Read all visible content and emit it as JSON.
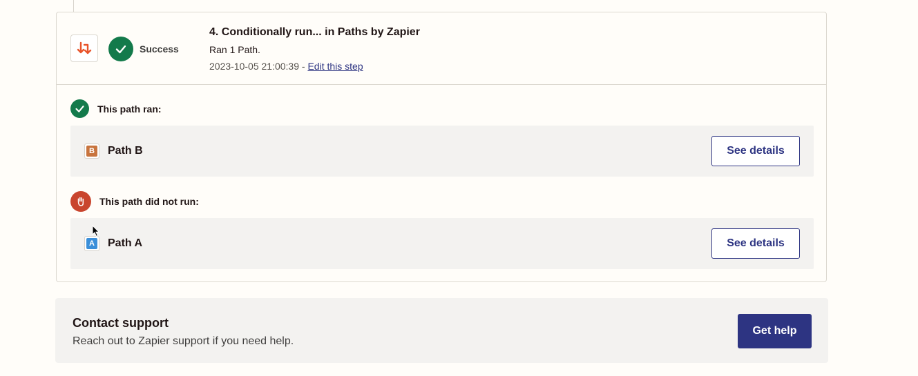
{
  "step": {
    "status": "Success",
    "title": "4. Conditionally run... in Paths by Zapier",
    "subtitle": "Ran 1 Path.",
    "timestamp": "2023-10-05 21:00:39",
    "separator": " - ",
    "edit_link": "Edit this step",
    "app_icon": "paths-arrows-icon",
    "status_icon": "checkmark-icon"
  },
  "ran_section": {
    "heading": "This path ran:",
    "icon": "checkmark-icon",
    "path": {
      "badge": "B",
      "badge_color": "#c8743e",
      "name": "Path B",
      "button": "See details"
    }
  },
  "not_ran_section": {
    "heading": "This path did not run:",
    "icon": "hand-stop-icon",
    "path": {
      "badge": "A",
      "badge_color": "#3b8fd9",
      "name": "Path A",
      "button": "See details"
    }
  },
  "support": {
    "title": "Contact support",
    "text": "Reach out to Zapier support if you need help.",
    "button": "Get help"
  },
  "colors": {
    "success": "#137a4b",
    "danger": "#c9452e",
    "primary": "#2d3482",
    "paths_orange": "#ff4f00"
  }
}
